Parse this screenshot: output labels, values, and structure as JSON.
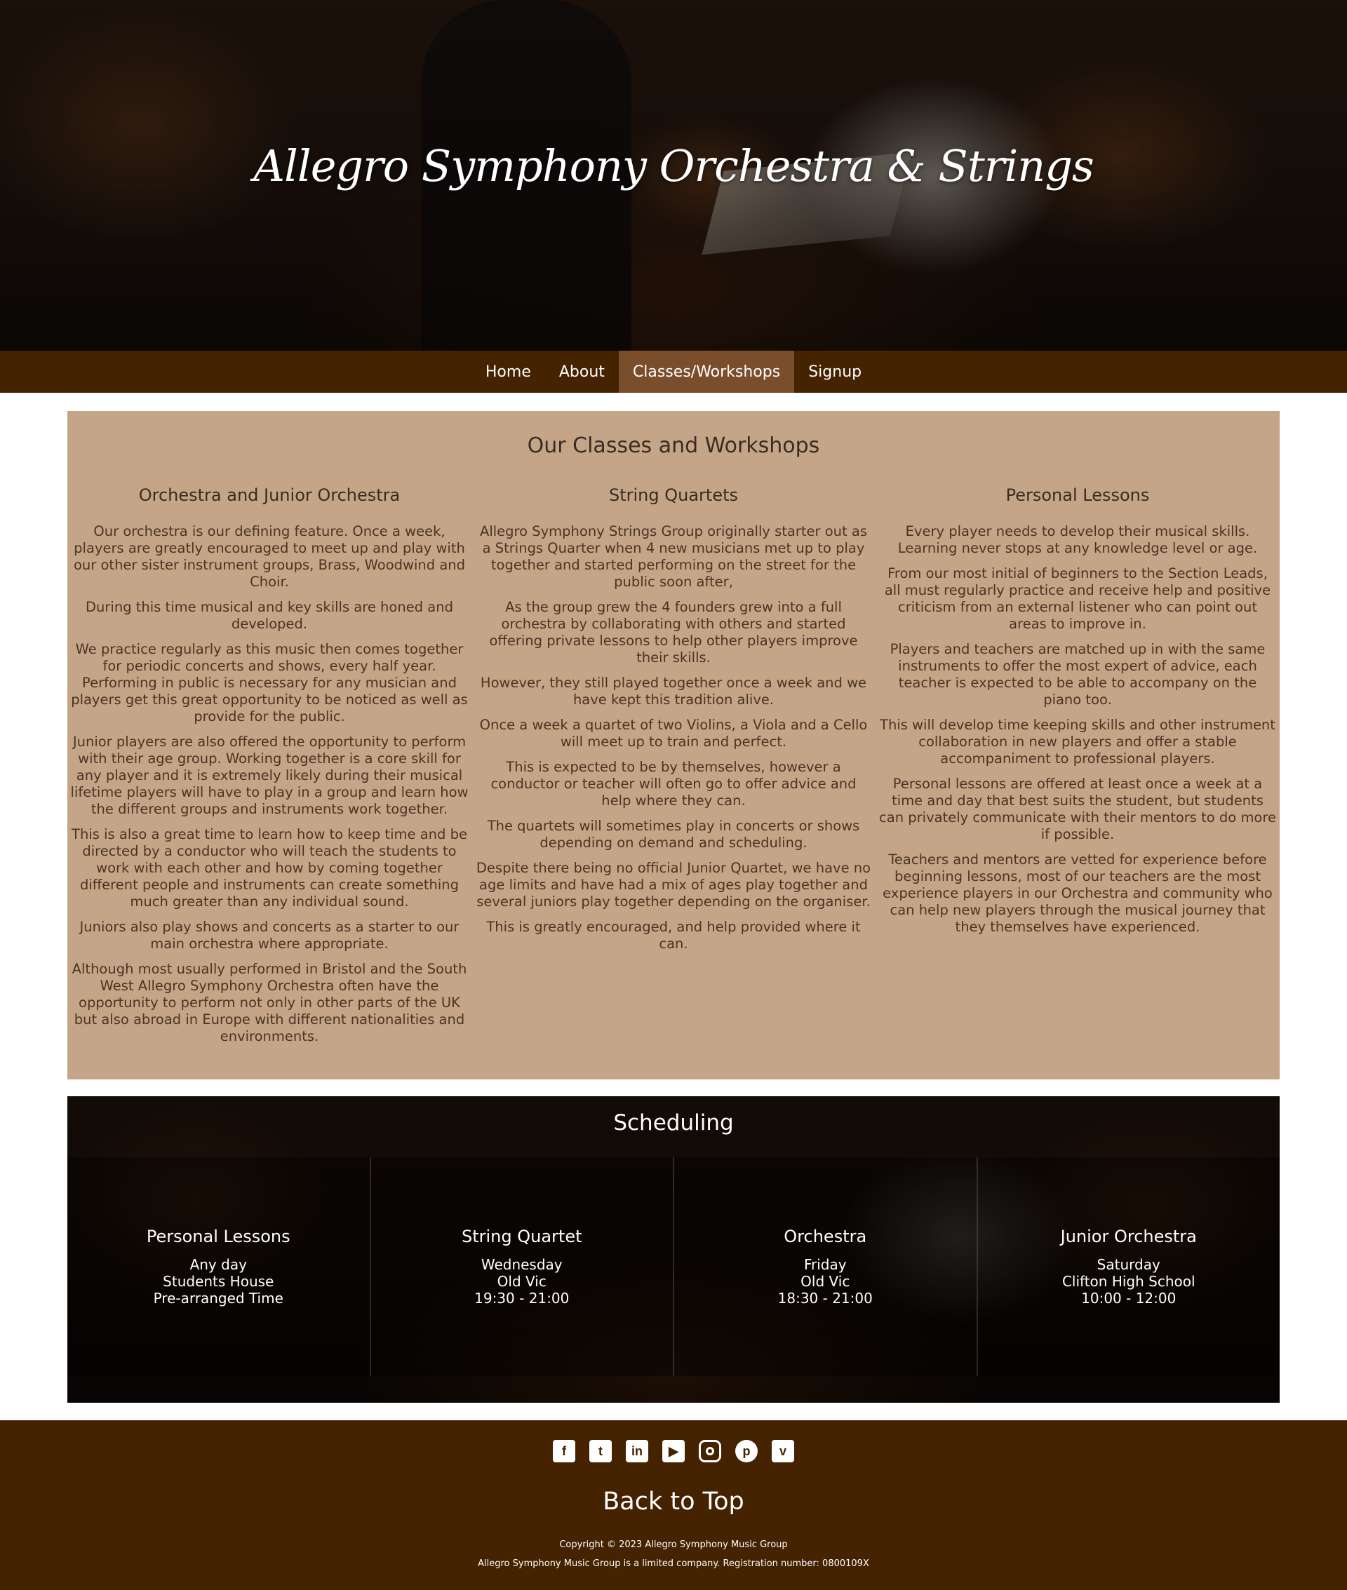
{
  "hero": {
    "title": "Allegro Symphony Orchestra & Strings"
  },
  "nav": [
    {
      "label": "Home"
    },
    {
      "label": "About"
    },
    {
      "label": "Classes/Workshops"
    },
    {
      "label": "Signup"
    }
  ],
  "classes": {
    "title": "Our Classes and Workshops",
    "columns": [
      {
        "heading": "Orchestra and Junior Orchestra",
        "paragraphs": [
          "Our orchestra is our defining feature. Once a week, players are greatly encouraged to meet up and play with our other sister instrument groups, Brass, Woodwind and Choir.",
          "During this time musical and key skills are honed and developed.",
          "We practice regularly as this music then comes together for periodic concerts and shows, every half year. Performing in public is necessary for any musician and players get this great opportunity to be noticed as well as provide for the public.",
          "Junior players are also offered the opportunity to perform with their age group. Working together is a core skill for any player and it is extremely likely during their musical lifetime players will have to play in a group and learn how the different groups and instruments work together.",
          "This is also a great time to learn how to keep time and be directed by a conductor who will teach the students to work with each other and how by coming together different people and instruments can create something much greater than any individual sound.",
          "Juniors also play shows and concerts as a starter to our main orchestra where appropriate.",
          "Although most usually performed in Bristol and the South West Allegro Symphony Orchestra often have the opportunity to perform not only in other parts of the UK but also abroad in Europe with different nationalities and environments."
        ]
      },
      {
        "heading": "String Quartets",
        "paragraphs": [
          "Allegro Symphony Strings Group originally starter out as a Strings Quarter when 4 new musicians met up to play together and started performing on the street for the public soon after,",
          "As the group grew the 4 founders grew into a full orchestra by collaborating with others and started offering private lessons to help other players improve their skills.",
          "However, they still played together once a week and we have kept this tradition alive.",
          "Once a week a quartet of two Violins, a Viola and a Cello will meet up to train and perfect.",
          "This is expected to be by themselves, however a conductor or teacher will often go to offer advice and help where they can.",
          "The quartets will sometimes play in concerts or shows depending on demand and scheduling.",
          "Despite there being no official Junior Quartet, we have no age limits and have had a mix of ages play together and several juniors play together depending on the organiser.",
          "This is greatly encouraged, and help provided where it can."
        ]
      },
      {
        "heading": "Personal Lessons",
        "paragraphs": [
          "Every player needs to develop their musical skills. Learning never stops at any knowledge level or age.",
          "From our most initial of beginners to the Section Leads, all must regularly practice and receive help and positive criticism from an external listener who can point out areas to improve in.",
          "Players and teachers are matched up in with the same instruments to offer the most expert of advice, each teacher is expected to be able to accompany on the piano too.",
          "This will develop time keeping skills and other instrument collaboration in new players and offer a stable accompaniment to professional players.",
          "Personal lessons are offered at least once a week at a time and day that best suits the student, but students can privately communicate with their mentors to do more if possible.",
          "Teachers and mentors are vetted for experience before beginning lessons, most of our teachers are the most experience players in our Orchestra and community who can help new players through the musical journey that they themselves have experienced."
        ]
      }
    ]
  },
  "scheduling": {
    "title": "Scheduling",
    "items": [
      {
        "name": "Personal Lessons",
        "day": "Any day",
        "place": "Students House",
        "time": "Pre-arranged Time"
      },
      {
        "name": "String Quartet",
        "day": "Wednesday",
        "place": "Old Vic",
        "time": "19:30 - 21:00"
      },
      {
        "name": "Orchestra",
        "day": "Friday",
        "place": "Old Vic",
        "time": "18:30 - 21:00"
      },
      {
        "name": "Junior Orchestra",
        "day": "Saturday",
        "place": "Clifton High School",
        "time": "10:00 - 12:00"
      }
    ]
  },
  "footer": {
    "social_icons": [
      "facebook-icon",
      "twitter-icon",
      "linkedin-icon",
      "youtube-icon",
      "instagram-icon",
      "pinterest-icon",
      "vimeo-icon"
    ],
    "back_to_top": "Back to Top",
    "copyright": "Copyright © 2023 Allegro Symphony Music Group",
    "registration": "Allegro Symphony Music Group is a limited company. Registration number: 0800109X"
  },
  "colors": {
    "nav_bg": "#452200",
    "nav_active": "#7a4d2b",
    "classes_bg": "#c5a587"
  }
}
